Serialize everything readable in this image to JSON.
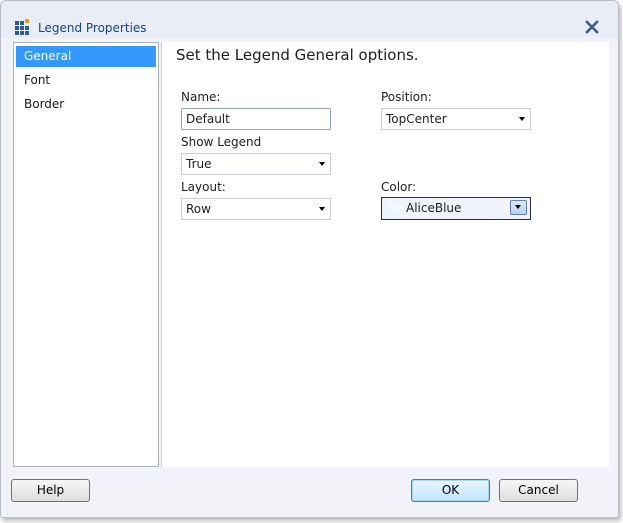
{
  "window": {
    "title": "Legend Properties"
  },
  "sidebar": {
    "items": [
      {
        "label": "General"
      },
      {
        "label": "Font"
      },
      {
        "label": "Border"
      }
    ]
  },
  "main": {
    "heading": "Set the Legend General options.",
    "name": {
      "label": "Name:",
      "value": "Default"
    },
    "position": {
      "label": "Position:",
      "value": "TopCenter"
    },
    "show_legend": {
      "label": "Show Legend",
      "value": "True"
    },
    "layout": {
      "label": "Layout:",
      "value": "Row"
    },
    "color": {
      "label": "Color:",
      "value": "AliceBlue",
      "swatch": "#f0f8ff"
    }
  },
  "footer": {
    "help_label": "Help",
    "ok_label": "OK",
    "cancel_label": "Cancel"
  },
  "colors": {
    "title_text": "#15428b",
    "selection": "#3399ff"
  },
  "icons": {
    "app_icon": "chart-grid-icon",
    "close_icon": "close-icon"
  }
}
